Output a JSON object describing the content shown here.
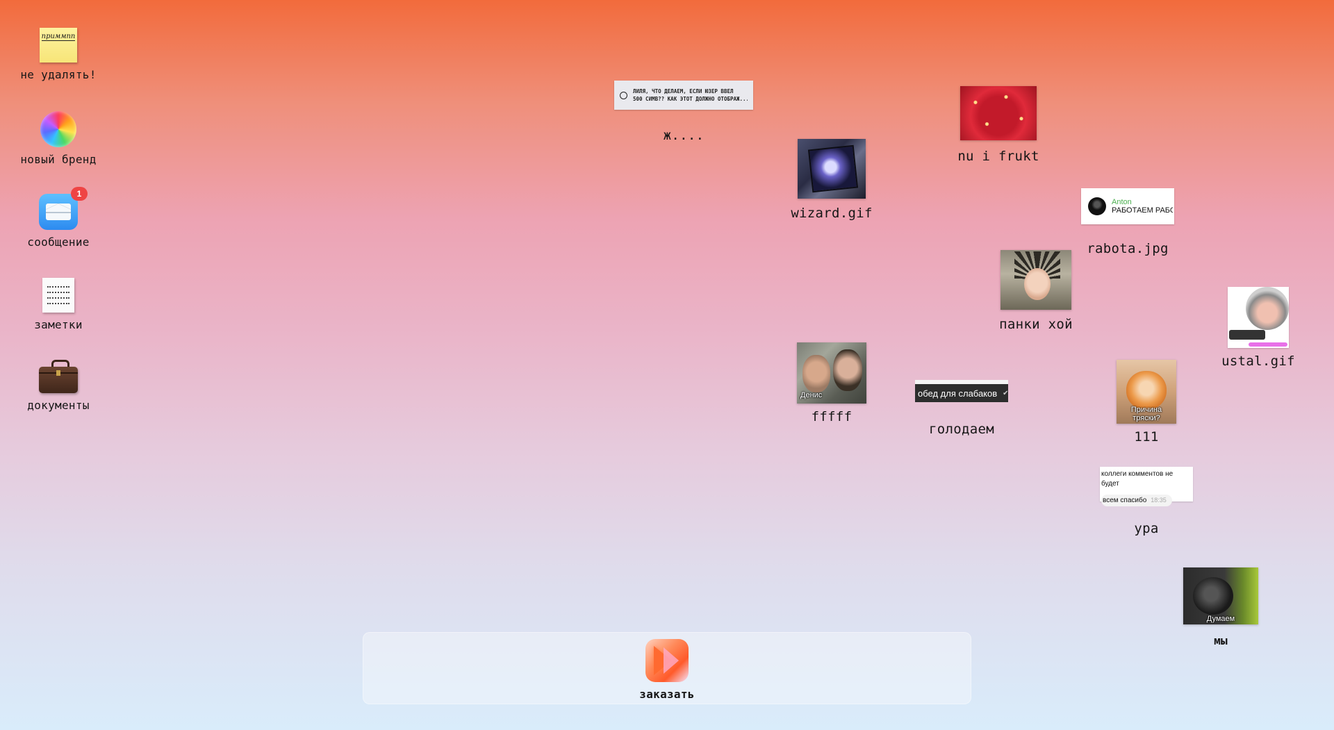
{
  "desktop": {
    "left_icons": [
      {
        "id": "sticky",
        "label": "не удалять!",
        "icon": "sticky-note-icon",
        "note_text": "приммпп"
      },
      {
        "id": "brand",
        "label": "новый бренд",
        "icon": "color-wheel-icon"
      },
      {
        "id": "mail",
        "label": "сообщение",
        "icon": "mail-icon",
        "badge": "1"
      },
      {
        "id": "notes",
        "label": "заметки",
        "icon": "notes-icon"
      },
      {
        "id": "docs",
        "label": "документы",
        "icon": "briefcase-icon"
      }
    ],
    "files": {
      "zh": {
        "label": "ж....",
        "preview": "ЛИЛЯ, ЧТО ДЕЛАЕМ, ЕСЛИ ЮЗЕР ВВЕЛ",
        "preview2": "500 СИМВ?? КАК ЭТОТ ДОЛЖНО ОТОБРАЖ..."
      },
      "nu_i_frukt": {
        "label": "nu i frukt"
      },
      "wizard": {
        "label": "wizard.gif"
      },
      "rabota": {
        "label": "rabota.jpg",
        "sender": "Anton",
        "text": "РАБОТАЕМ РАБОТАЕМ"
      },
      "panki": {
        "label": "панки хой"
      },
      "ustal": {
        "label": "ustal.gif"
      },
      "fffff": {
        "label": "fffff",
        "caption": "Денис"
      },
      "golodaem": {
        "label": "голодаем",
        "text": "обед для слабаков"
      },
      "one11": {
        "label": "111",
        "caption": "Причина тряски?"
      },
      "ura": {
        "label": "ура",
        "line1": "коллеги комментов не будет",
        "line2": "всем спасибо",
        "time": "18:35"
      },
      "my": {
        "label": "мы",
        "caption": "Думаем"
      }
    }
  },
  "dock": {
    "items": [
      {
        "label": "заказать",
        "icon": "order-app-icon"
      }
    ]
  }
}
